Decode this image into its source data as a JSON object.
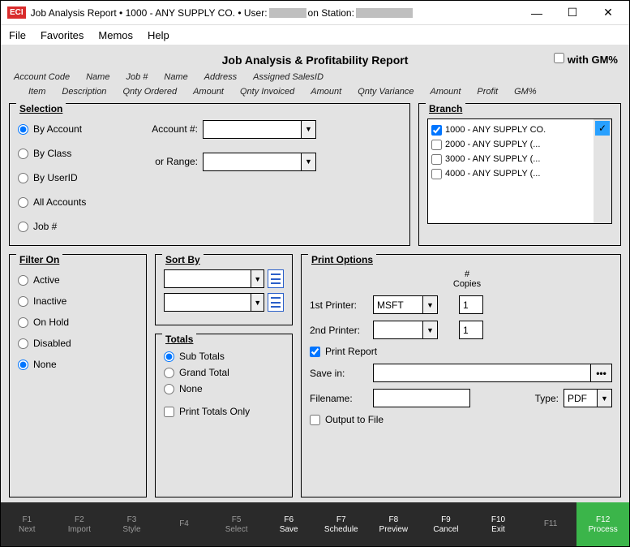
{
  "titlebar": {
    "app_tag": "ECI",
    "title": "Job Analysis Report  •  1000 - ANY SUPPLY CO.  •  User:",
    "station_label": "on Station:"
  },
  "menu": {
    "file": "File",
    "favorites": "Favorites",
    "memos": "Memos",
    "help": "Help"
  },
  "header": {
    "title": "Job Analysis & Profitability Report",
    "with_gm": "with GM%"
  },
  "columns1": [
    "Account Code",
    "Name",
    "Job #",
    "Name",
    "Address",
    "Assigned SalesID"
  ],
  "columns2": [
    "Item",
    "Description",
    "Qnty Ordered",
    "Amount",
    "Qnty Invoiced",
    "Amount",
    "Qnty Variance",
    "Amount",
    "Profit",
    "GM%"
  ],
  "selection": {
    "legend": "Selection",
    "by_account": "By Account",
    "by_class": "By Class",
    "by_userid": "By UserID",
    "all_accounts": "All Accounts",
    "job_no": "Job #",
    "account_no_label": "Account #:",
    "or_range_label": "or Range:",
    "account_value": "",
    "range_value": ""
  },
  "branch": {
    "legend": "Branch",
    "items": [
      {
        "label": "1000 - ANY SUPPLY CO.",
        "checked": true
      },
      {
        "label": "2000 - ANY SUPPLY (...",
        "checked": false
      },
      {
        "label": "3000 - ANY SUPPLY (...",
        "checked": false
      },
      {
        "label": "4000 - ANY SUPPLY (...",
        "checked": false
      }
    ]
  },
  "filter": {
    "legend": "Filter On",
    "active": "Active",
    "inactive": "Inactive",
    "on_hold": "On Hold",
    "disabled": "Disabled",
    "none": "None"
  },
  "sort": {
    "legend": "Sort By",
    "sort1": "",
    "sort2": ""
  },
  "totals": {
    "legend": "Totals",
    "sub": "Sub Totals",
    "grand": "Grand Total",
    "none": "None",
    "print_only": "Print Totals Only"
  },
  "print": {
    "legend": "Print Options",
    "copies_header": "# Copies",
    "printer1_label": "1st Printer:",
    "printer1_value": "MSFT",
    "copies1": "1",
    "printer2_label": "2nd Printer:",
    "printer2_value": "",
    "copies2": "1",
    "print_report": "Print Report",
    "save_in_label": "Save in:",
    "save_in_value": "",
    "filename_label": "Filename:",
    "filename_value": "",
    "type_label": "Type:",
    "type_value": "PDF",
    "output_file": "Output to File"
  },
  "fkeys": [
    {
      "k": "F1",
      "l": "Next",
      "on": false
    },
    {
      "k": "F2",
      "l": "Import",
      "on": false
    },
    {
      "k": "F3",
      "l": "Style",
      "on": false
    },
    {
      "k": "F4",
      "l": "",
      "on": false
    },
    {
      "k": "F5",
      "l": "Select",
      "on": false
    },
    {
      "k": "F6",
      "l": "Save",
      "on": true
    },
    {
      "k": "F7",
      "l": "Schedule",
      "on": true
    },
    {
      "k": "F8",
      "l": "Preview",
      "on": true
    },
    {
      "k": "F9",
      "l": "Cancel",
      "on": true
    },
    {
      "k": "F10",
      "l": "Exit",
      "on": true
    },
    {
      "k": "F11",
      "l": "",
      "on": false
    },
    {
      "k": "F12",
      "l": "Process",
      "on": true,
      "process": true
    }
  ]
}
